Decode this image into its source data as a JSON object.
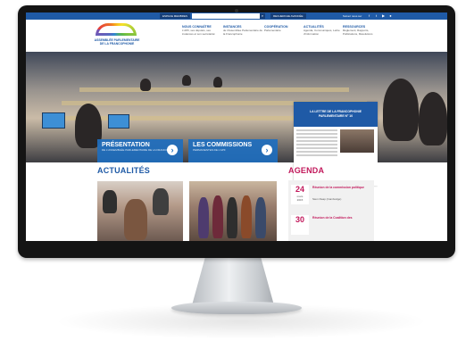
{
  "topbar": {
    "button_left": "ESPACE MEMBRES",
    "search_placeholder": "",
    "button_right": "RECHERCHE AVANCÉE",
    "follow_label": "Suivez nous sur",
    "social_icons": [
      "facebook-icon",
      "twitter-icon",
      "youtube-icon",
      "flickr-icon"
    ]
  },
  "logo": {
    "line1": "ASSEMBLÉE PARLEMENTAIRE",
    "line2": "DE LA FRANCOPHONIE"
  },
  "nav": [
    {
      "title": "NOUS CONNAÎTRE",
      "desc": "L'APF, ses députés, ses instances et son secrétariat"
    },
    {
      "title": "INSTANCES",
      "desc": "de l'Assemblée Parlementaire de la Francophonie"
    },
    {
      "title": "COOPÉRATION",
      "desc": "Parlementaire"
    },
    {
      "title": "ACTUALITÉS",
      "desc": "Agenda, Communiqués, Lettre d'information"
    },
    {
      "title": "RESSOURCES",
      "desc": "Règlement, Rapports, Publications, Résolutions"
    }
  ],
  "hero": {
    "promo1_title": "PRÉSENTATION",
    "promo1_sub": "DE L'ASSEMBLÉE PARLEMENTAIRE DE LA FRANCOPHONIE",
    "promo2_title": "LES COMMISSIONS",
    "promo2_sub": "PERMANENTES DE L'APF",
    "arrow": "›"
  },
  "newsletter": {
    "title_line1": "LA LETTRE DE LA FRANCOPHONIE",
    "title_line2": "PARLEMENTAIRE N° 10"
  },
  "sections": {
    "actualites": "ACTUALITÉS",
    "agenda": "AGENDA"
  },
  "agenda_items": [
    {
      "day": "24",
      "month": "mars",
      "year": "2015",
      "title": "Réunion de la commission politique",
      "desc": "Siem Reap (Cambodge)"
    },
    {
      "day": "30",
      "month": "",
      "year": "",
      "title": "Réunion de la Coalition des",
      "desc": ""
    }
  ],
  "colors": {
    "brand_blue": "#1f5aa6",
    "promo_blue": "#1e6ebe",
    "agenda_pink": "#c2185b"
  }
}
